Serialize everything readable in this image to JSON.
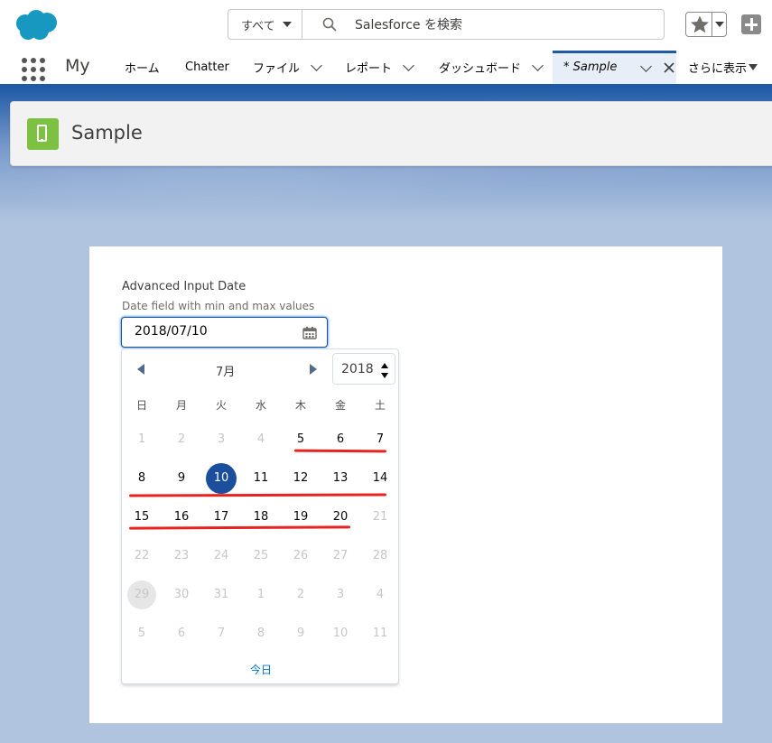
{
  "header": {
    "search_scope": "すべて",
    "search_placeholder": "Salesforce を検索"
  },
  "nav": {
    "app_name": "My",
    "tabs": [
      {
        "label": "ホーム",
        "has_menu": false
      },
      {
        "label": "Chatter",
        "has_menu": false
      },
      {
        "label": "ファイル",
        "has_menu": true
      },
      {
        "label": "レポート",
        "has_menu": true
      },
      {
        "label": "ダッシュボード",
        "has_menu": true
      }
    ],
    "active_tab": "* Sample",
    "more_label": "さらに表示"
  },
  "page": {
    "title": "Sample",
    "icon": "mobile-icon"
  },
  "field": {
    "label": "Advanced Input Date",
    "help": "Date field with min and max values",
    "value": "2018/07/10"
  },
  "picker": {
    "month": "7月",
    "year": "2018",
    "weekdays": [
      "日",
      "月",
      "火",
      "水",
      "木",
      "金",
      "土"
    ],
    "weeks": [
      [
        {
          "d": "1",
          "s": "out"
        },
        {
          "d": "2",
          "s": "out"
        },
        {
          "d": "3",
          "s": "out"
        },
        {
          "d": "4",
          "s": "out"
        },
        {
          "d": "5",
          "s": "in"
        },
        {
          "d": "6",
          "s": "in"
        },
        {
          "d": "7",
          "s": "in"
        }
      ],
      [
        {
          "d": "8",
          "s": "in"
        },
        {
          "d": "9",
          "s": "in"
        },
        {
          "d": "10",
          "s": "selected"
        },
        {
          "d": "11",
          "s": "in"
        },
        {
          "d": "12",
          "s": "in"
        },
        {
          "d": "13",
          "s": "in"
        },
        {
          "d": "14",
          "s": "in"
        }
      ],
      [
        {
          "d": "15",
          "s": "in"
        },
        {
          "d": "16",
          "s": "in"
        },
        {
          "d": "17",
          "s": "in"
        },
        {
          "d": "18",
          "s": "in"
        },
        {
          "d": "19",
          "s": "in"
        },
        {
          "d": "20",
          "s": "in"
        },
        {
          "d": "21",
          "s": "out"
        }
      ],
      [
        {
          "d": "22",
          "s": "out"
        },
        {
          "d": "23",
          "s": "out"
        },
        {
          "d": "24",
          "s": "out"
        },
        {
          "d": "25",
          "s": "out"
        },
        {
          "d": "26",
          "s": "out"
        },
        {
          "d": "27",
          "s": "out"
        },
        {
          "d": "28",
          "s": "out"
        }
      ],
      [
        {
          "d": "29",
          "s": "today"
        },
        {
          "d": "30",
          "s": "out"
        },
        {
          "d": "31",
          "s": "out"
        },
        {
          "d": "1",
          "s": "out"
        },
        {
          "d": "2",
          "s": "out"
        },
        {
          "d": "3",
          "s": "out"
        },
        {
          "d": "4",
          "s": "out"
        }
      ],
      [
        {
          "d": "5",
          "s": "out"
        },
        {
          "d": "6",
          "s": "out"
        },
        {
          "d": "7",
          "s": "out"
        },
        {
          "d": "8",
          "s": "out"
        },
        {
          "d": "9",
          "s": "out"
        },
        {
          "d": "10",
          "s": "out"
        },
        {
          "d": "11",
          "s": "out"
        }
      ]
    ],
    "today_label": "今日"
  },
  "colors": {
    "brand_blue": "#1f5aa6",
    "selected_day": "#1b4f9e",
    "annotation_red": "#e8231f",
    "object_icon_green": "#7dc142"
  }
}
